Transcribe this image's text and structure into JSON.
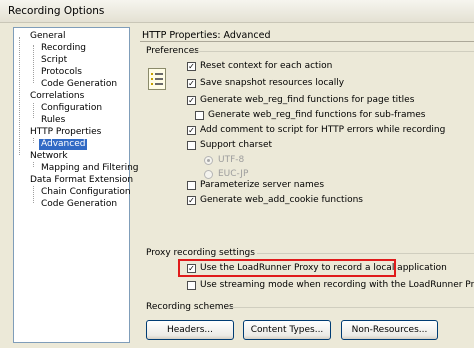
{
  "window": {
    "title": "Recording Options"
  },
  "tree": [
    {
      "label": "General",
      "level": 0,
      "selected": false
    },
    {
      "label": "Recording",
      "level": 1,
      "selected": false
    },
    {
      "label": "Script",
      "level": 1,
      "selected": false
    },
    {
      "label": "Protocols",
      "level": 1,
      "selected": false
    },
    {
      "label": "Code Generation",
      "level": 1,
      "selected": false
    },
    {
      "label": "Correlations",
      "level": 0,
      "selected": false
    },
    {
      "label": "Configuration",
      "level": 1,
      "selected": false
    },
    {
      "label": "Rules",
      "level": 1,
      "selected": false
    },
    {
      "label": "HTTP Properties",
      "level": 0,
      "selected": false
    },
    {
      "label": "Advanced",
      "level": 1,
      "selected": true
    },
    {
      "label": "Network",
      "level": 0,
      "selected": false
    },
    {
      "label": "Mapping and Filtering",
      "level": 1,
      "selected": false
    },
    {
      "label": "Data Format Extension",
      "level": 0,
      "selected": false
    },
    {
      "label": "Chain Configuration",
      "level": 1,
      "selected": false
    },
    {
      "label": "Code Generation",
      "level": 1,
      "selected": false
    }
  ],
  "header": {
    "title": "HTTP Properties: Advanced"
  },
  "preferences": {
    "label": "Preferences",
    "options": [
      {
        "label": "Reset context for each action",
        "checked": true,
        "enabled": true,
        "indent": 0
      },
      {
        "label": "Save snapshot resources locally",
        "checked": true,
        "enabled": true,
        "indent": 0
      },
      {
        "label": "Generate web_reg_find functions for page titles",
        "checked": true,
        "enabled": true,
        "indent": 0
      },
      {
        "label": "Generate web_reg_find functions for sub-frames",
        "checked": false,
        "enabled": true,
        "indent": 1
      },
      {
        "label": "Add comment to script for HTTP errors while recording",
        "checked": true,
        "enabled": true,
        "indent": 0
      },
      {
        "label": "Support charset",
        "checked": false,
        "enabled": true,
        "indent": 0
      }
    ],
    "charsets": [
      {
        "label": "UTF-8",
        "selected": true
      },
      {
        "label": "EUC-JP",
        "selected": false
      }
    ],
    "options_after": [
      {
        "label": "Parameterize server names",
        "checked": false
      },
      {
        "label": "Generate web_add_cookie functions",
        "checked": true
      }
    ]
  },
  "proxy": {
    "label": "Proxy recording settings",
    "options": [
      {
        "label": "Use the LoadRunner Proxy to record a local application",
        "checked": true,
        "highlighted": true
      },
      {
        "label": "Use streaming mode when recording with the LoadRunner Proxy",
        "checked": false,
        "highlighted": false
      }
    ]
  },
  "schemes": {
    "label": "Recording schemes",
    "buttons": {
      "headers": "Headers...",
      "content_types": "Content Types...",
      "non_resources": "Non-Resources..."
    }
  },
  "colors": {
    "selection": "#316ac5",
    "highlight_border": "#e01b1b",
    "dialog_bg": "#ece9d8"
  },
  "icons": {
    "preferences": "preferences-list-icon",
    "check": "checkmark-icon"
  }
}
